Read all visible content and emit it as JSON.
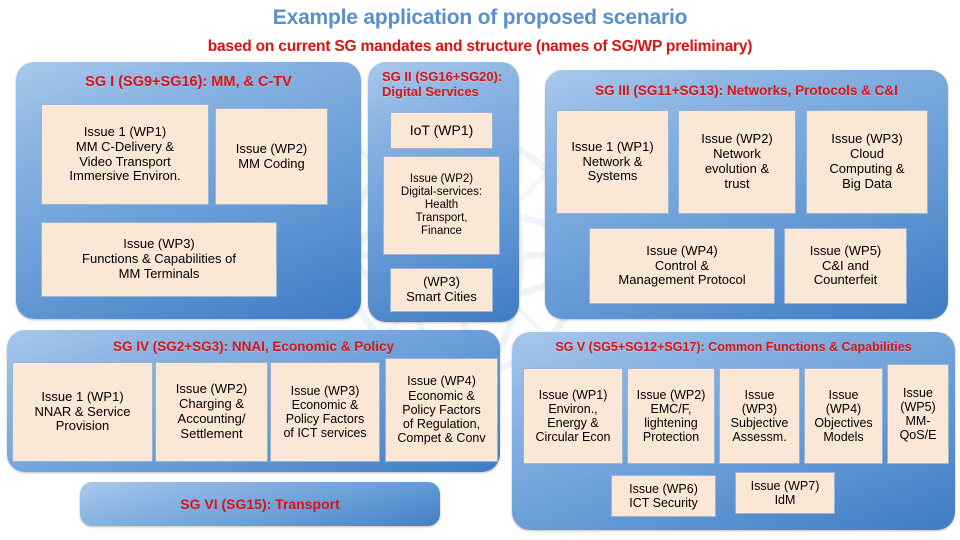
{
  "header": {
    "title": "Example application of proposed scenario",
    "subtitle": "based on current SG mandates and structure (names of SG/WP preliminary)",
    "title_color": "#5b8fc9",
    "subtitle_color": "#dd1111"
  },
  "style": {
    "panel_blue_light": "#a8c8ec",
    "panel_blue_dark": "#3f7cc4",
    "box_fill": "#fbe7d5",
    "box_border": "#9ab4d4",
    "panel_title_color": "#d81414"
  },
  "panels": [
    {
      "id": "sg1",
      "title": "SG I (SG9+SG16): MM, & C-TV",
      "boxes": [
        {
          "name": "sg1-wp1",
          "lines": [
            "Issue 1 (WP1)",
            "MM C-Delivery &",
            "Video Transport",
            "Immersive Environ."
          ]
        },
        {
          "name": "sg1-wp2",
          "lines": [
            "Issue (WP2)",
            "MM Coding"
          ]
        },
        {
          "name": "sg1-wp3",
          "lines": [
            "Issue (WP3)",
            "Functions & Capabilities of",
            "MM Terminals"
          ]
        }
      ]
    },
    {
      "id": "sg2",
      "title": "SG II (SG16+SG20): Digital Services",
      "boxes": [
        {
          "name": "sg2-wp1",
          "lines": [
            "IoT (WP1)"
          ]
        },
        {
          "name": "sg2-wp2",
          "lines": [
            "Issue (WP2)",
            "Digital-services:",
            "Health",
            "Transport,",
            "Finance"
          ]
        },
        {
          "name": "sg2-wp3",
          "lines": [
            "(WP3)",
            "Smart Cities"
          ]
        }
      ]
    },
    {
      "id": "sg3",
      "title": "SG III (SG11+SG13): Networks, Protocols & C&I",
      "boxes": [
        {
          "name": "sg3-wp1",
          "lines": [
            "Issue 1 (WP1)",
            "Network &",
            "Systems"
          ]
        },
        {
          "name": "sg3-wp2",
          "lines": [
            "Issue (WP2)",
            "Network",
            "evolution &",
            "trust"
          ]
        },
        {
          "name": "sg3-wp3",
          "lines": [
            "Issue (WP3)",
            "Cloud",
            "Computing &",
            "Big Data"
          ]
        },
        {
          "name": "sg3-wp4",
          "lines": [
            "Issue (WP4)",
            "Control &",
            "Management Protocol"
          ]
        },
        {
          "name": "sg3-wp5",
          "lines": [
            "Issue (WP5)",
            "C&I and",
            "Counterfeit"
          ]
        }
      ]
    },
    {
      "id": "sg4",
      "title": "SG IV (SG2+SG3): NNAI, Economic & Policy",
      "boxes": [
        {
          "name": "sg4-wp1",
          "lines": [
            "Issue 1 (WP1)",
            "NNAR & Service",
            "Provision"
          ]
        },
        {
          "name": "sg4-wp2",
          "lines": [
            "Issue (WP2)",
            "Charging &",
            "Accounting/",
            "Settlement"
          ]
        },
        {
          "name": "sg4-wp3",
          "lines": [
            "Issue (WP3)",
            "Economic &",
            "Policy Factors",
            "of ICT services"
          ]
        },
        {
          "name": "sg4-wp4",
          "lines": [
            "Issue (WP4)",
            "Economic &",
            "Policy Factors",
            "of Regulation,",
            "Compet & Conv"
          ]
        }
      ]
    },
    {
      "id": "sg5",
      "title": "SG V (SG5+SG12+SG17): Common Functions & Capabilities",
      "boxes": [
        {
          "name": "sg5-wp1",
          "lines": [
            "Issue (WP1)",
            "Environ.,",
            "Energy &",
            "Circular Econ"
          ]
        },
        {
          "name": "sg5-wp2",
          "lines": [
            "Issue (WP2)",
            "EMC/F,",
            "lightening",
            "Protection"
          ]
        },
        {
          "name": "sg5-wp3",
          "lines": [
            "Issue",
            "(WP3)",
            "Subjective",
            "Assessm."
          ]
        },
        {
          "name": "sg5-wp4",
          "lines": [
            "Issue",
            "(WP4)",
            "Objectives",
            "Models"
          ]
        },
        {
          "name": "sg5-wp5",
          "lines": [
            "Issue",
            "(WP5)",
            "MM-",
            "QoS/E"
          ]
        },
        {
          "name": "sg5-wp6",
          "lines": [
            "Issue (WP6)",
            "ICT Security"
          ]
        },
        {
          "name": "sg5-wp7",
          "lines": [
            "Issue (WP7)",
            "IdM"
          ]
        }
      ]
    }
  ],
  "sg6": {
    "title": "SG VI (SG15): Transport"
  }
}
